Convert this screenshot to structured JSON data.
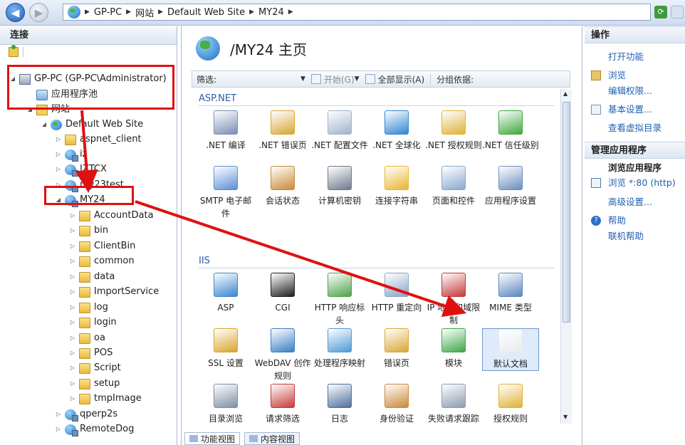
{
  "nav": {
    "breadcrumb": [
      "GP-PC",
      "网站",
      "Default Web Site",
      "MY24"
    ]
  },
  "left": {
    "title": "连接",
    "tree": [
      {
        "id": "server",
        "label": "GP-PC (GP-PC\\Administrator)",
        "icon": "server-icon"
      },
      {
        "id": "apppools",
        "label": "应用程序池",
        "icon": "app-pool-icon"
      },
      {
        "id": "sites",
        "label": "网站",
        "icon": "sites-folder-icon"
      },
      {
        "id": "default",
        "label": "Default Web Site",
        "icon": "website-globe-icon"
      },
      {
        "id": "aspnet",
        "label": "aspnet_client",
        "icon": "folder-icon"
      },
      {
        "id": "iz",
        "label": "iz",
        "icon": "web-app-icon"
      },
      {
        "id": "iztcx",
        "label": "IZTCX",
        "icon": "web-app-icon"
      },
      {
        "id": "my23",
        "label": "my23test",
        "icon": "web-app-icon"
      },
      {
        "id": "my24",
        "label": "MY24",
        "icon": "web-app-icon"
      },
      {
        "id": "f1",
        "label": "AccountData",
        "icon": "folder-icon"
      },
      {
        "id": "f2",
        "label": "bin",
        "icon": "folder-icon"
      },
      {
        "id": "f3",
        "label": "ClientBin",
        "icon": "folder-icon"
      },
      {
        "id": "f4",
        "label": "common",
        "icon": "folder-icon"
      },
      {
        "id": "f5",
        "label": "data",
        "icon": "folder-icon"
      },
      {
        "id": "f6",
        "label": "ImportService",
        "icon": "folder-icon"
      },
      {
        "id": "f7",
        "label": "log",
        "icon": "folder-icon"
      },
      {
        "id": "f8",
        "label": "login",
        "icon": "folder-icon"
      },
      {
        "id": "f9",
        "label": "oa",
        "icon": "folder-icon"
      },
      {
        "id": "f10",
        "label": "POS",
        "icon": "folder-icon"
      },
      {
        "id": "f11",
        "label": "Script",
        "icon": "folder-icon"
      },
      {
        "id": "f12",
        "label": "setup",
        "icon": "folder-icon"
      },
      {
        "id": "f13",
        "label": "tmpImage",
        "icon": "folder-icon"
      },
      {
        "id": "qperp",
        "label": "qperp2s",
        "icon": "web-app-icon"
      },
      {
        "id": "remote",
        "label": "RemoteDog",
        "icon": "web-app-icon"
      }
    ]
  },
  "center": {
    "title": "/MY24 主页",
    "filter": {
      "label": "筛选:",
      "start": "开始(G)",
      "show_all": "全部显示(A)",
      "group_by": "分组依据:"
    },
    "sections": {
      "aspnet": "ASP.NET",
      "iis": "IIS"
    },
    "features": [
      {
        "label": ".NET 编译",
        "icon": "dotnet-compile-icon",
        "color": "#7a8fb5"
      },
      {
        "label": ".NET 错误页",
        "icon": "dotnet-error-page-icon",
        "color": "#d9a637"
      },
      {
        "label": ".NET 配置文件",
        "icon": "dotnet-profile-icon",
        "color": "#9fb3cc"
      },
      {
        "label": ".NET 全球化",
        "icon": "dotnet-globalization-icon",
        "color": "#2f86d4"
      },
      {
        "label": ".NET 授权规则",
        "icon": "dotnet-authorization-icon",
        "color": "#e0b23a"
      },
      {
        "label": ".NET 信任级别",
        "icon": "dotnet-trust-icon",
        "color": "#3ea83c"
      },
      {
        "label": "SMTP 电子邮件",
        "icon": "smtp-email-icon",
        "color": "#5c8fd6"
      },
      {
        "label": "会话状态",
        "icon": "session-state-icon",
        "color": "#c98a3a"
      },
      {
        "label": "计算机密钥",
        "icon": "machine-key-icon",
        "color": "#6f7b8c"
      },
      {
        "label": "连接字符串",
        "icon": "connection-string-icon",
        "color": "#e8b62f"
      },
      {
        "label": "页面和控件",
        "icon": "pages-controls-icon",
        "color": "#8aa9cf"
      },
      {
        "label": "应用程序设置",
        "icon": "app-settings-icon",
        "color": "#6b8fbf"
      },
      {
        "label": "ASP",
        "icon": "asp-icon",
        "color": "#3b86d0"
      },
      {
        "label": "CGI",
        "icon": "cgi-icon",
        "color": "#202020"
      },
      {
        "label": "HTTP 响应标头",
        "icon": "http-headers-icon",
        "color": "#4fa14c"
      },
      {
        "label": "HTTP 重定向",
        "icon": "http-redirect-icon",
        "color": "#8aa6c8"
      },
      {
        "label": "IP 地址和域限制",
        "icon": "ip-restrictions-icon",
        "color": "#c43a3a"
      },
      {
        "label": "MIME 类型",
        "icon": "mime-types-icon",
        "color": "#5f87bf"
      },
      {
        "label": "SSL 设置",
        "icon": "ssl-lock-icon",
        "color": "#d9a42c"
      },
      {
        "label": "WebDAV 创作规则",
        "icon": "webdav-icon",
        "color": "#3a7fc4"
      },
      {
        "label": "处理程序映射",
        "icon": "handler-mappings-icon",
        "color": "#4f9ad6"
      },
      {
        "label": "错误页",
        "icon": "error-pages-icon",
        "color": "#d9a637"
      },
      {
        "label": "模块",
        "icon": "modules-icon",
        "color": "#3fa74a"
      },
      {
        "label": "默认文档",
        "icon": "default-document-icon",
        "color": "#e6e9ee"
      },
      {
        "label": "目录浏览",
        "icon": "directory-browsing-icon",
        "color": "#7d8fa6"
      },
      {
        "label": "请求筛选",
        "icon": "request-filtering-icon",
        "color": "#c73a3a"
      },
      {
        "label": "日志",
        "icon": "logging-icon",
        "color": "#4e6f9e"
      },
      {
        "label": "身份验证",
        "icon": "authentication-icon",
        "color": "#c98a3a"
      },
      {
        "label": "失败请求跟踪规则",
        "icon": "failed-request-tracing-icon",
        "color": "#8c9bb0"
      },
      {
        "label": "授权规则",
        "icon": "authorization-rules-icon",
        "color": "#e0b23a"
      }
    ],
    "tabs": {
      "features_view": "功能视图",
      "content_view": "内容视图"
    }
  },
  "right": {
    "title": "操作",
    "open_feature": "打开功能",
    "explore": "浏览",
    "edit_permissions": "编辑权限...",
    "basic_settings": "基本设置...",
    "view_vdirs": "查看虚拟目录",
    "manage_app": "管理应用程序",
    "browse_app": "浏览应用程序",
    "browse_80": "浏览 *:80 (http)",
    "advanced": "高级设置...",
    "help": "帮助",
    "online_help": "联机帮助"
  },
  "colors": {
    "annotation": "#e01010",
    "link": "#1f5fb1",
    "section": "#2a5ea8"
  }
}
